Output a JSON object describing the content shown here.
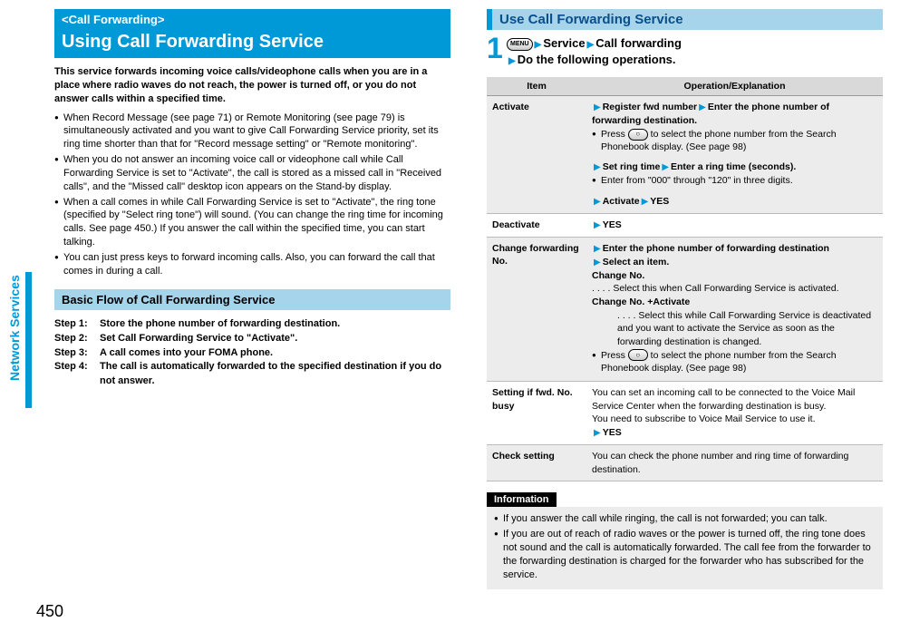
{
  "side_label": "Network Services",
  "page_number": "450",
  "left": {
    "breadcrumb": "<Call Forwarding>",
    "title": "Using Call Forwarding Service",
    "intro": "This service forwards incoming voice calls/videophone calls when you are in a place where radio waves do not reach, the power is turned off, or you do not answer calls within a specified time.",
    "bullets": [
      "When Record Message (see page 71) or Remote Monitoring (see page 79) is simultaneously activated and you want to give Call Forwarding Service priority, set its ring time shorter than that for \"Record message setting\" or \"Remote monitoring\".",
      "When you do not answer an incoming voice call or videophone call while Call Forwarding Service is set to \"Activate\", the call is stored as a missed call in \"Received calls\", and the \"Missed call\" desktop icon appears on the Stand-by display.",
      "When a call comes in while Call Forwarding Service is set to \"Activate\", the ring tone (specified by \"Select ring tone\") will sound. (You can change the ring time for incoming calls. See page 450.) If you answer the call within the specified time, you can start talking.",
      "You can just press keys to forward incoming calls. Also, you can forward the call that comes in during a call."
    ],
    "flow_heading": "Basic Flow of Call Forwarding Service",
    "steps": [
      {
        "label": "Step 1:",
        "text": "Store the phone number of forwarding destination."
      },
      {
        "label": "Step 2:",
        "text": "Set Call Forwarding Service to \"Activate\"."
      },
      {
        "label": "Step 3:",
        "text": "A call comes into your FOMA phone."
      },
      {
        "label": "Step 4:",
        "text": "The call is automatically forwarded to the specified destination if you do not answer."
      }
    ]
  },
  "right": {
    "title": "Use Call Forwarding Service",
    "menu_label": "MENU",
    "nav_service": "Service",
    "nav_cf": "Call forwarding",
    "nav_do": "Do the following operations.",
    "table_headers": {
      "item": "Item",
      "op": "Operation/Explanation"
    },
    "rows": {
      "activate": {
        "item": "Activate",
        "l1a": "Register fwd number",
        "l1b": "Enter the phone number of forwarding destination.",
        "l2": "Press ",
        "l2b": " to select the phone number from the Search Phonebook display. (See page 98)",
        "l3a": "Set ring time",
        "l3b": "Enter a ring time (seconds).",
        "l4": "Enter from \"000\" through \"120\" in three digits.",
        "l5a": "Activate",
        "l5b": "YES"
      },
      "deactivate": {
        "item": "Deactivate",
        "op": "YES"
      },
      "change": {
        "item": "Change forwarding No.",
        "l1": "Enter the phone number of forwarding destination",
        "l2": "Select an item.",
        "l3": "Change No.",
        "l3d": ". . . .  Select this when Call Forwarding Service is activated.",
        "l4": "Change No. +Activate",
        "l4d": ". . . .  Select this while Call Forwarding Service is deactivated and you want to activate the Service as soon as the forwarding destination is changed.",
        "l5": "Press ",
        "l5b": " to select the phone number from the Search Phonebook display. (See page 98)"
      },
      "busy": {
        "item": "Setting if fwd. No. busy",
        "t1": "You can set an incoming call to be connected to the Voice Mail Service Center when the forwarding destination is busy.",
        "t2": "You need to subscribe to Voice Mail Service to use it.",
        "t3": "YES"
      },
      "check": {
        "item": "Check setting",
        "t": "You can check the phone number and ring time of forwarding destination."
      }
    },
    "info_header": "Information",
    "info_bullets": [
      "If you answer the call while ringing, the call is not forwarded; you can talk.",
      "If you are out of reach of radio waves or the power is turned off, the ring tone does not sound and the call is automatically forwarded. The call fee from the forwarder to the forwarding destination is charged for the forwarder who has subscribed for the service."
    ]
  }
}
